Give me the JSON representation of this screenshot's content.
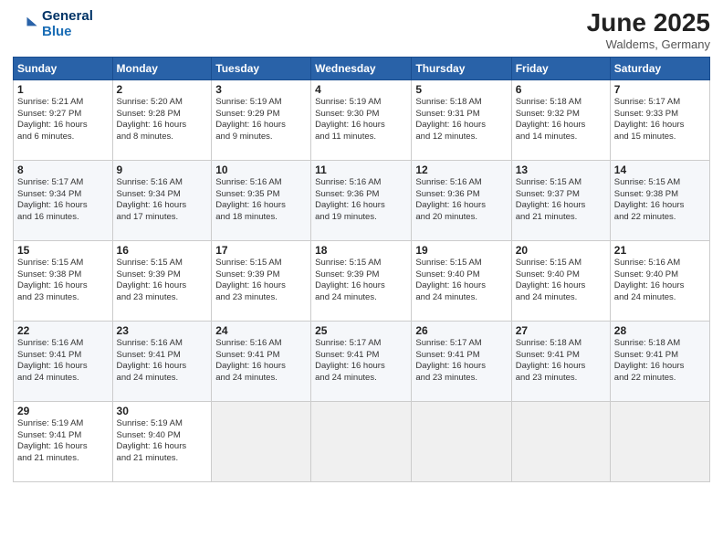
{
  "header": {
    "logo_line1": "General",
    "logo_line2": "Blue",
    "month_year": "June 2025",
    "location": "Waldems, Germany"
  },
  "weekdays": [
    "Sunday",
    "Monday",
    "Tuesday",
    "Wednesday",
    "Thursday",
    "Friday",
    "Saturday"
  ],
  "weeks": [
    [
      {
        "day": "1",
        "sunrise": "5:21 AM",
        "sunset": "9:27 PM",
        "daylight": "16 hours and 6 minutes."
      },
      {
        "day": "2",
        "sunrise": "5:20 AM",
        "sunset": "9:28 PM",
        "daylight": "16 hours and 8 minutes."
      },
      {
        "day": "3",
        "sunrise": "5:19 AM",
        "sunset": "9:29 PM",
        "daylight": "16 hours and 9 minutes."
      },
      {
        "day": "4",
        "sunrise": "5:19 AM",
        "sunset": "9:30 PM",
        "daylight": "16 hours and 11 minutes."
      },
      {
        "day": "5",
        "sunrise": "5:18 AM",
        "sunset": "9:31 PM",
        "daylight": "16 hours and 12 minutes."
      },
      {
        "day": "6",
        "sunrise": "5:18 AM",
        "sunset": "9:32 PM",
        "daylight": "16 hours and 14 minutes."
      },
      {
        "day": "7",
        "sunrise": "5:17 AM",
        "sunset": "9:33 PM",
        "daylight": "16 hours and 15 minutes."
      }
    ],
    [
      {
        "day": "8",
        "sunrise": "5:17 AM",
        "sunset": "9:34 PM",
        "daylight": "16 hours and 16 minutes."
      },
      {
        "day": "9",
        "sunrise": "5:16 AM",
        "sunset": "9:34 PM",
        "daylight": "16 hours and 17 minutes."
      },
      {
        "day": "10",
        "sunrise": "5:16 AM",
        "sunset": "9:35 PM",
        "daylight": "16 hours and 18 minutes."
      },
      {
        "day": "11",
        "sunrise": "5:16 AM",
        "sunset": "9:36 PM",
        "daylight": "16 hours and 19 minutes."
      },
      {
        "day": "12",
        "sunrise": "5:16 AM",
        "sunset": "9:36 PM",
        "daylight": "16 hours and 20 minutes."
      },
      {
        "day": "13",
        "sunrise": "5:15 AM",
        "sunset": "9:37 PM",
        "daylight": "16 hours and 21 minutes."
      },
      {
        "day": "14",
        "sunrise": "5:15 AM",
        "sunset": "9:38 PM",
        "daylight": "16 hours and 22 minutes."
      }
    ],
    [
      {
        "day": "15",
        "sunrise": "5:15 AM",
        "sunset": "9:38 PM",
        "daylight": "16 hours and 23 minutes."
      },
      {
        "day": "16",
        "sunrise": "5:15 AM",
        "sunset": "9:39 PM",
        "daylight": "16 hours and 23 minutes."
      },
      {
        "day": "17",
        "sunrise": "5:15 AM",
        "sunset": "9:39 PM",
        "daylight": "16 hours and 23 minutes."
      },
      {
        "day": "18",
        "sunrise": "5:15 AM",
        "sunset": "9:39 PM",
        "daylight": "16 hours and 24 minutes."
      },
      {
        "day": "19",
        "sunrise": "5:15 AM",
        "sunset": "9:40 PM",
        "daylight": "16 hours and 24 minutes."
      },
      {
        "day": "20",
        "sunrise": "5:15 AM",
        "sunset": "9:40 PM",
        "daylight": "16 hours and 24 minutes."
      },
      {
        "day": "21",
        "sunrise": "5:16 AM",
        "sunset": "9:40 PM",
        "daylight": "16 hours and 24 minutes."
      }
    ],
    [
      {
        "day": "22",
        "sunrise": "5:16 AM",
        "sunset": "9:41 PM",
        "daylight": "16 hours and 24 minutes."
      },
      {
        "day": "23",
        "sunrise": "5:16 AM",
        "sunset": "9:41 PM",
        "daylight": "16 hours and 24 minutes."
      },
      {
        "day": "24",
        "sunrise": "5:16 AM",
        "sunset": "9:41 PM",
        "daylight": "16 hours and 24 minutes."
      },
      {
        "day": "25",
        "sunrise": "5:17 AM",
        "sunset": "9:41 PM",
        "daylight": "16 hours and 24 minutes."
      },
      {
        "day": "26",
        "sunrise": "5:17 AM",
        "sunset": "9:41 PM",
        "daylight": "16 hours and 23 minutes."
      },
      {
        "day": "27",
        "sunrise": "5:18 AM",
        "sunset": "9:41 PM",
        "daylight": "16 hours and 23 minutes."
      },
      {
        "day": "28",
        "sunrise": "5:18 AM",
        "sunset": "9:41 PM",
        "daylight": "16 hours and 22 minutes."
      }
    ],
    [
      {
        "day": "29",
        "sunrise": "5:19 AM",
        "sunset": "9:41 PM",
        "daylight": "16 hours and 21 minutes."
      },
      {
        "day": "30",
        "sunrise": "5:19 AM",
        "sunset": "9:40 PM",
        "daylight": "16 hours and 21 minutes."
      },
      null,
      null,
      null,
      null,
      null
    ]
  ],
  "labels": {
    "sunrise": "Sunrise: ",
    "sunset": "Sunset: ",
    "daylight": "Daylight: "
  }
}
